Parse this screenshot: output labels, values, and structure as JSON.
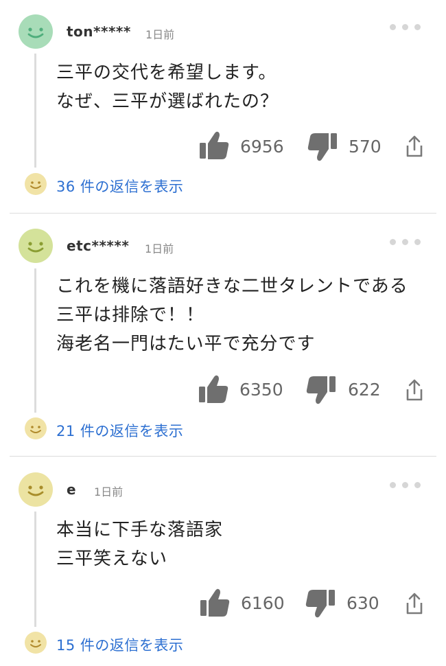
{
  "comments": [
    {
      "username": "ton*****",
      "time": "1日前",
      "avatar_color": "#a8dcb8",
      "lines": [
        "三平の交代を希望します。",
        "なぜ、三平が選ばれたの？"
      ],
      "likes": "6956",
      "dislikes": "570",
      "replies_label": "36 件の返信を表示"
    },
    {
      "username": "etc*****",
      "time": "1日前",
      "avatar_color": "#d4e29a",
      "lines": [
        "これを機に落語好きな二世タレントである",
        "三平は排除で！！",
        "海老名一門はたい平で充分です"
      ],
      "likes": "6350",
      "dislikes": "622",
      "replies_label": "21 件の返信を表示"
    },
    {
      "username": "e",
      "time": "1日前",
      "avatar_color": "#ece3a2",
      "lines": [
        "本当に下手な落語家",
        "三平笑えない"
      ],
      "likes": "6160",
      "dislikes": "630",
      "replies_label": "15 件の返信を表示"
    }
  ],
  "icons": {
    "like": "thumbs-up-icon",
    "dislike": "thumbs-down-icon",
    "share": "share-icon",
    "more": "more-options-icon",
    "reply_avatar_color": "#f1e3a6"
  }
}
